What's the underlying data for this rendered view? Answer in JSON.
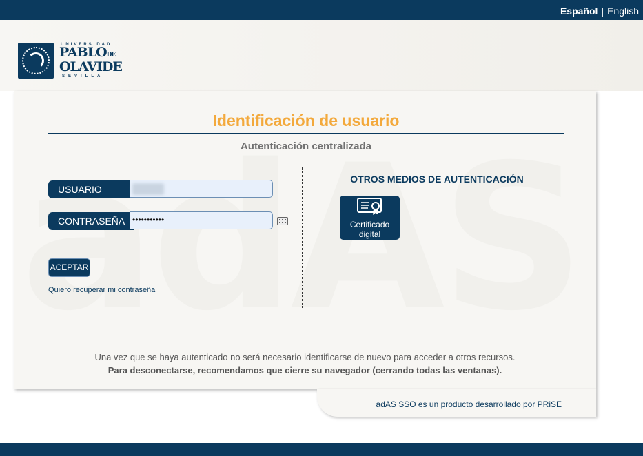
{
  "lang": {
    "active": "Español",
    "separator": "|",
    "other": "English"
  },
  "logo": {
    "top": "UNIVERSIDAD",
    "name_line1": "PABLO",
    "name_de": "DE",
    "name_line2": "OLAVIDE",
    "bottom": "SEVILLA"
  },
  "watermark": "adAS",
  "main": {
    "title": "Identificación de usuario",
    "subtitle": "Autenticación centralizada"
  },
  "form": {
    "user_label": "USUARIO",
    "password_label": "CONTRASEÑA",
    "password_value": "•••••••••••",
    "accept_label": "ACEPTAR",
    "recover_label": "Quiero recuperar mi contraseña"
  },
  "other": {
    "title": "OTROS MEDIOS DE AUTENTICACIÓN",
    "cert_line1": "Certificado",
    "cert_line2": "digital"
  },
  "info": {
    "line1": "Una vez que se haya autenticado no será necesario identificarse de nuevo para acceder a otros recursos.",
    "line2": "Para desconectarse, recomendamos que cierre su navegador (cerrando todas las ventanas)."
  },
  "credits": "adAS SSO es un producto desarrollado por PRiSE",
  "colors": {
    "brand": "#0b3a5e",
    "accent": "#f3a93c"
  }
}
